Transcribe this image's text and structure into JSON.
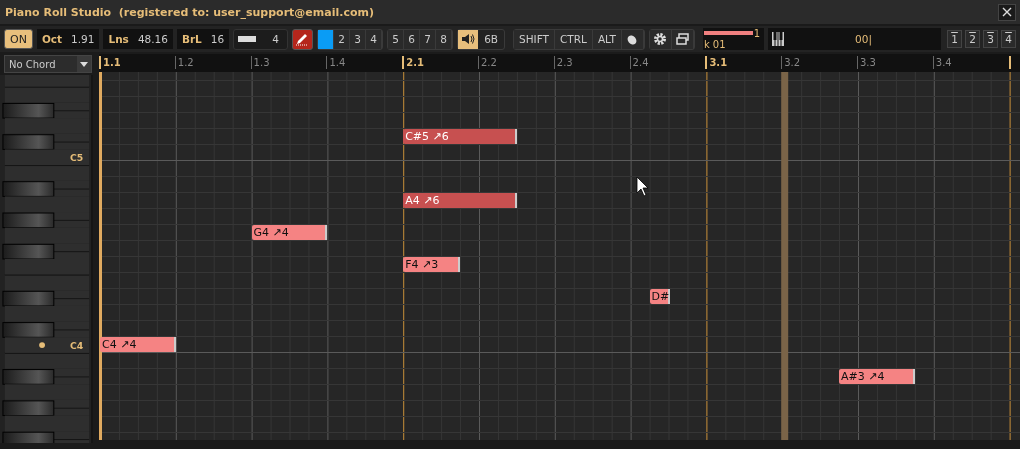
{
  "window": {
    "title": "Piano Roll Studio  (registered to: user_support@email.com)"
  },
  "toolbar": {
    "power": {
      "label": "ON",
      "on": true
    },
    "fields": [
      {
        "label": "Oct",
        "value": "1.91"
      },
      {
        "label": "Lns",
        "value": "48.16"
      },
      {
        "label": "BrL",
        "value": "16"
      }
    ],
    "zoom": {
      "value": "4"
    },
    "pencil": {
      "on": true
    },
    "channels": [
      {
        "selected": true
      },
      {
        "label": "2",
        "selected": false
      },
      {
        "label": "3",
        "selected": false
      },
      {
        "label": "4",
        "selected": false
      },
      {
        "label": "5",
        "selected": false
      },
      {
        "label": "6",
        "selected": false
      },
      {
        "label": "7",
        "selected": false
      },
      {
        "label": "8",
        "selected": false
      }
    ],
    "sound": {
      "on": true,
      "value": "6B"
    },
    "modifiers": [
      "SHIFT",
      "CTRL",
      "ALT"
    ],
    "meter": {
      "level": 0.86,
      "count": "1",
      "name": "k 01"
    },
    "input": {
      "value": "00|"
    },
    "presets": [
      "1",
      "2",
      "3",
      "4"
    ]
  },
  "chord": {
    "value": "No Chord"
  },
  "ruler": [
    {
      "label": "1.1",
      "bar": true
    },
    {
      "label": "1.2",
      "bar": false
    },
    {
      "label": "1.3",
      "bar": false
    },
    {
      "label": "1.4",
      "bar": false
    },
    {
      "label": "2.1",
      "bar": true
    },
    {
      "label": "2.2",
      "bar": false
    },
    {
      "label": "2.3",
      "bar": false
    },
    {
      "label": "2.4",
      "bar": false
    },
    {
      "label": "3.1",
      "bar": true
    },
    {
      "label": "3.2",
      "bar": false
    },
    {
      "label": "3.3",
      "bar": false
    },
    {
      "label": "3.4",
      "bar": false
    }
  ],
  "lanes": [
    {
      "black": false
    },
    {
      "black": false
    },
    {
      "black": true
    },
    {
      "black": false
    },
    {
      "black": true,
      "notes": [
        {
          "text": "C#5 ↗6",
          "selected": true
        }
      ]
    },
    {
      "black": false,
      "label": "C5"
    },
    {
      "black": false
    },
    {
      "black": true
    },
    {
      "black": false,
      "notes": [
        {
          "text": "A4 ↗6",
          "selected": true
        }
      ]
    },
    {
      "black": true
    },
    {
      "black": false,
      "notes": [
        {
          "text": "G4 ↗4",
          "selected": false
        }
      ]
    },
    {
      "black": true
    },
    {
      "black": false,
      "notes": [
        {
          "text": "F4 ↗3",
          "selected": false
        }
      ]
    },
    {
      "black": false
    },
    {
      "black": true,
      "notes": [
        {
          "text": "D#",
          "selected": false
        }
      ]
    },
    {
      "black": false
    },
    {
      "black": true
    },
    {
      "black": false,
      "label": "C4",
      "marked": true,
      "notes": [
        {
          "text": "C4 ↗4",
          "selected": false
        }
      ]
    },
    {
      "black": false
    },
    {
      "black": true,
      "notes": [
        {
          "text": "A#3 ↗4",
          "selected": false
        }
      ]
    },
    {
      "black": false
    },
    {
      "black": true
    },
    {
      "black": false
    },
    {
      "black": true
    }
  ]
}
